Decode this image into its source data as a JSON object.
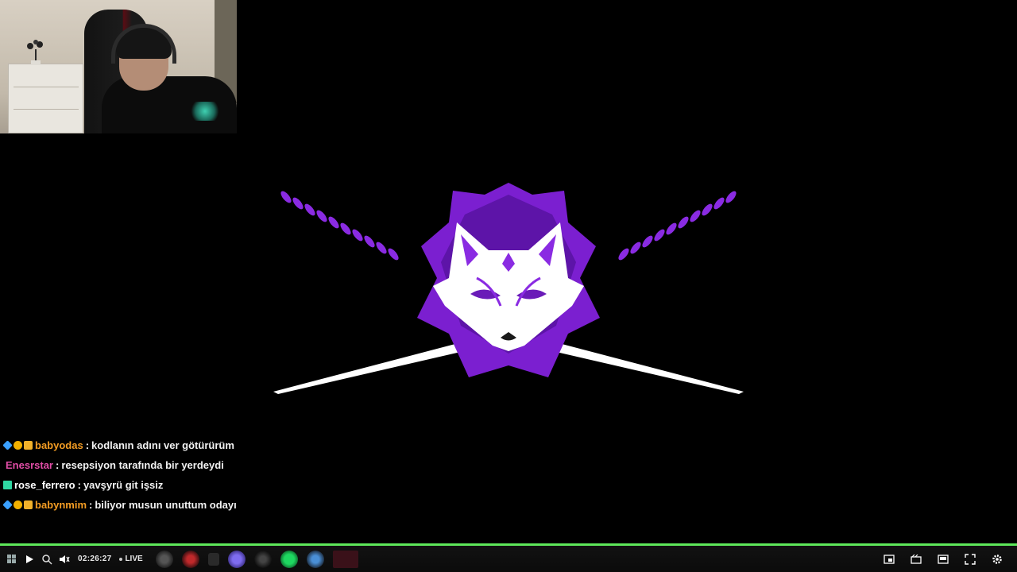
{
  "chat": {
    "lines": [
      {
        "username": "babyodas",
        "separator": ":",
        "message": "kodlanın adını ver götürürüm",
        "color": "#f39c23"
      },
      {
        "username": "Enesrstar",
        "separator": ":",
        "message": "resepsiyon tarafında bir yerdeydi",
        "color": "#e14da6"
      },
      {
        "username": "rose_ferrero",
        "separator": ":",
        "message": "yavşyrü git işsiz",
        "color": "#ffffff"
      },
      {
        "username": "babynmim",
        "separator": ":",
        "message": "biliyor musun unuttum odayı",
        "color": "#f39c23"
      }
    ]
  },
  "player": {
    "elapsed": "02:26:27",
    "live_label": "LIVE",
    "progress_color": "#5ee85a",
    "accent": "#8a2be2"
  },
  "icons": {
    "play": "play-icon",
    "volume": "muted-volume-icon",
    "theater": "theater-icon",
    "pip": "picture-in-picture-icon",
    "fullscreen": "fullscreen-icon",
    "settings": "gear-icon"
  }
}
